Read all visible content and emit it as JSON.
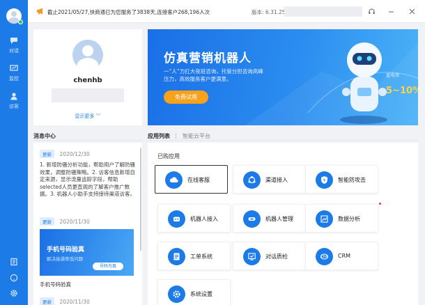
{
  "notice": "截止2021/05/27,快商通已为您服务了3838天,连接客户268,196人次",
  "version": "版本: 6.31.25",
  "rail": {
    "items": [
      "对话",
      "监控",
      "访客"
    ]
  },
  "profile": {
    "username": "chenhb",
    "show_more": "显示更多 ﹀"
  },
  "banner": {
    "title": "仿真营销机器人",
    "desc": "一“人”力扛大夜班咨询，托管分担咨询高峰压力，高效服务客户更满意。",
    "trial_button": "免费试用",
    "rate_label": "套电率",
    "rate_value": "5~10%"
  },
  "message_center": {
    "title": "消息中心",
    "items": [
      {
        "tag": "更新",
        "date": "2020/12/30",
        "body": "1. 新增防骚分析功能，帮助用户了解防骚效果，调整防骚策略。2. 访客信息新增自定来源，显示流量追踪字段，帮助selected人员更直观的了解客户推广数据。3. 机器人小助手支持接待渠道访客。"
      },
      {
        "tag": "更新",
        "date": "2020/11/30",
        "image_title": "手机号码验真",
        "image_sub": "解决接通率低问题",
        "image_pill": "号码为真",
        "caption": "手机号码验真"
      },
      {
        "tag": "更新",
        "date": "2020/11/30"
      }
    ]
  },
  "tabs": {
    "active": "应用列表",
    "separator": "|",
    "other": "智能云平台"
  },
  "apps": {
    "section_title": "已购应用",
    "items": [
      {
        "name": "在线客服",
        "icon": "cloud-chat-icon"
      },
      {
        "name": "渠道接入",
        "icon": "network-icon"
      },
      {
        "name": "智能防攻击",
        "icon": "shield-bolt-icon"
      },
      {
        "name": "机器人接入",
        "icon": "robot-icon"
      },
      {
        "name": "机器人管理",
        "icon": "robot-manage-icon"
      },
      {
        "name": "数据分析",
        "icon": "chart-icon"
      },
      {
        "name": "工单系统",
        "icon": "form-icon"
      },
      {
        "name": "对话质检",
        "icon": "quality-check-icon"
      },
      {
        "name": "CRM",
        "icon": "crm-icon"
      },
      {
        "name": "系统设置",
        "icon": "gear-icon"
      }
    ]
  },
  "colors": {
    "primary": "#1d7be8",
    "trial_button": "#f8a21b",
    "rate": "#ffd24a",
    "online": "#2ec36b"
  }
}
